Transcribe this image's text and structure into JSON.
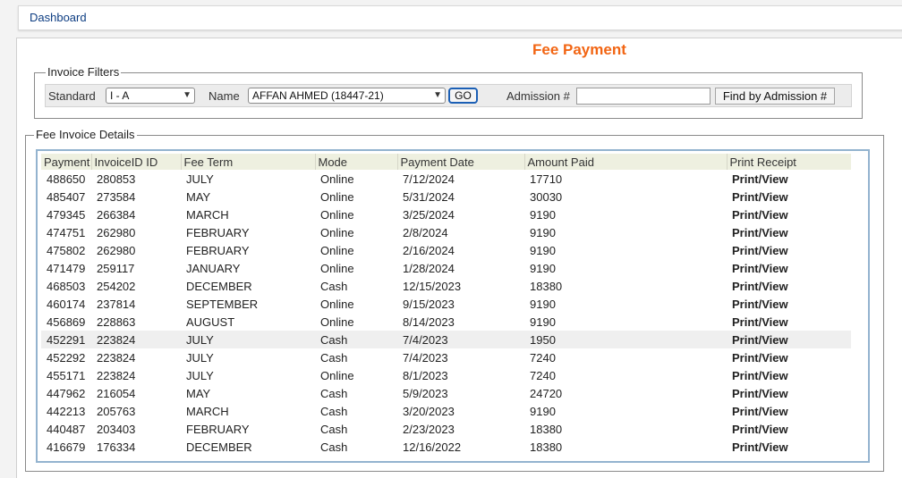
{
  "nav": {
    "dashboard_label": "Dashboard"
  },
  "page": {
    "title": "Fee Payment"
  },
  "filters": {
    "legend": "Invoice Filters",
    "standard_label": "Standard",
    "standard_value": "I - A",
    "name_label": "Name",
    "name_value": "AFFAN AHMED (18447-21)",
    "go_label": "GO",
    "admission_label": "Admission #",
    "admission_value": "",
    "find_label": "Find by Admission #"
  },
  "details": {
    "legend": "Fee Invoice Details",
    "columns": [
      "Payment",
      "InvoiceID ID",
      "Fee Term",
      "Mode",
      "Payment Date",
      "Amount Paid",
      "Print Receipt"
    ],
    "print_label": "Print/View",
    "rows": [
      [
        "488650",
        "280853",
        "JULY",
        "Online",
        "7/12/2024",
        "17710"
      ],
      [
        "485407",
        "273584",
        "MAY",
        "Online",
        "5/31/2024",
        "30030"
      ],
      [
        "479345",
        "266384",
        "MARCH",
        "Online",
        "3/25/2024",
        "9190"
      ],
      [
        "474751",
        "262980",
        "FEBRUARY",
        "Online",
        "2/8/2024",
        "9190"
      ],
      [
        "475802",
        "262980",
        "FEBRUARY",
        "Online",
        "2/16/2024",
        "9190"
      ],
      [
        "471479",
        "259117",
        "JANUARY",
        "Online",
        "1/28/2024",
        "9190"
      ],
      [
        "468503",
        "254202",
        "DECEMBER",
        "Cash",
        "12/15/2023",
        "18380"
      ],
      [
        "460174",
        "237814",
        "SEPTEMBER",
        "Online",
        "9/15/2023",
        "9190"
      ],
      [
        "456869",
        "228863",
        "AUGUST",
        "Online",
        "8/14/2023",
        "9190"
      ],
      [
        "452291",
        "223824",
        "JULY",
        "Cash",
        "7/4/2023",
        "1950"
      ],
      [
        "452292",
        "223824",
        "JULY",
        "Cash",
        "7/4/2023",
        "7240"
      ],
      [
        "455171",
        "223824",
        "JULY",
        "Online",
        "8/1/2023",
        "7240"
      ],
      [
        "447962",
        "216054",
        "MAY",
        "Cash",
        "5/9/2023",
        "24720"
      ],
      [
        "442213",
        "205763",
        "MARCH",
        "Cash",
        "3/20/2023",
        "9190"
      ],
      [
        "440487",
        "203403",
        "FEBRUARY",
        "Cash",
        "2/23/2023",
        "18380"
      ],
      [
        "416679",
        "176334",
        "DECEMBER",
        "Cash",
        "12/16/2022",
        "18380"
      ]
    ],
    "highlighted_row": 9
  },
  "colors": {
    "title": "#f26513",
    "print_link": "#1a8a12",
    "nav_link": "#0d3d82"
  }
}
